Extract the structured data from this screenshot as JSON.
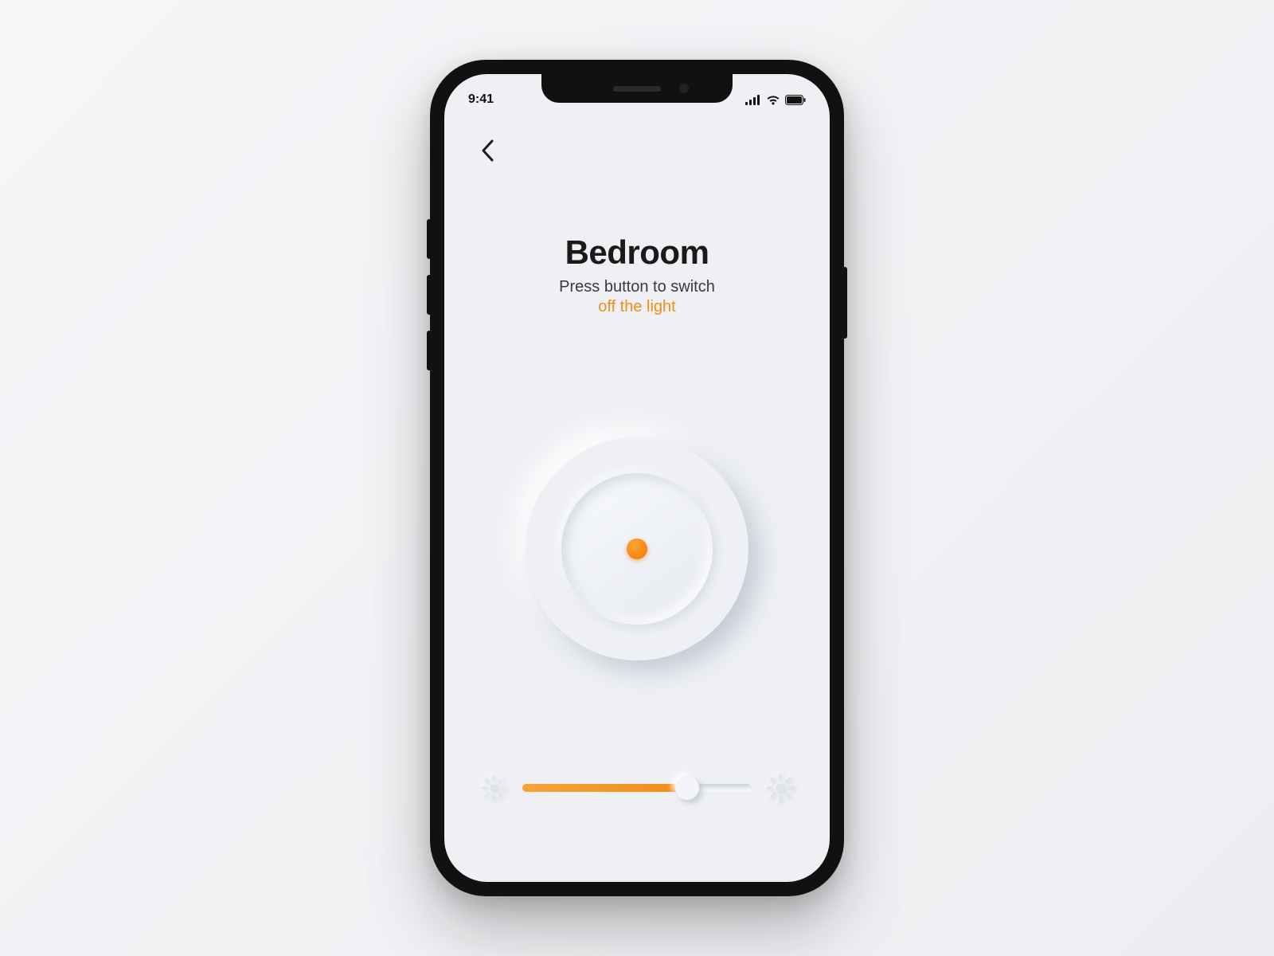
{
  "status": {
    "time": "9:41",
    "icons": {
      "signal": "signal-icon",
      "wifi": "wifi-icon",
      "battery": "battery-icon"
    }
  },
  "nav": {
    "back_icon": "chevron-left-icon"
  },
  "header": {
    "title": "Bedroom",
    "subtitle_line1": "Press button to switch",
    "subtitle_line2": "off the light"
  },
  "power": {
    "state_icon": "power-dot-icon"
  },
  "brightness": {
    "low_icon": "brightness-low-icon",
    "high_icon": "brightness-high-icon",
    "value_percent": 72
  },
  "colors": {
    "accent": "#f28c1a",
    "background": "#eef0f4"
  }
}
